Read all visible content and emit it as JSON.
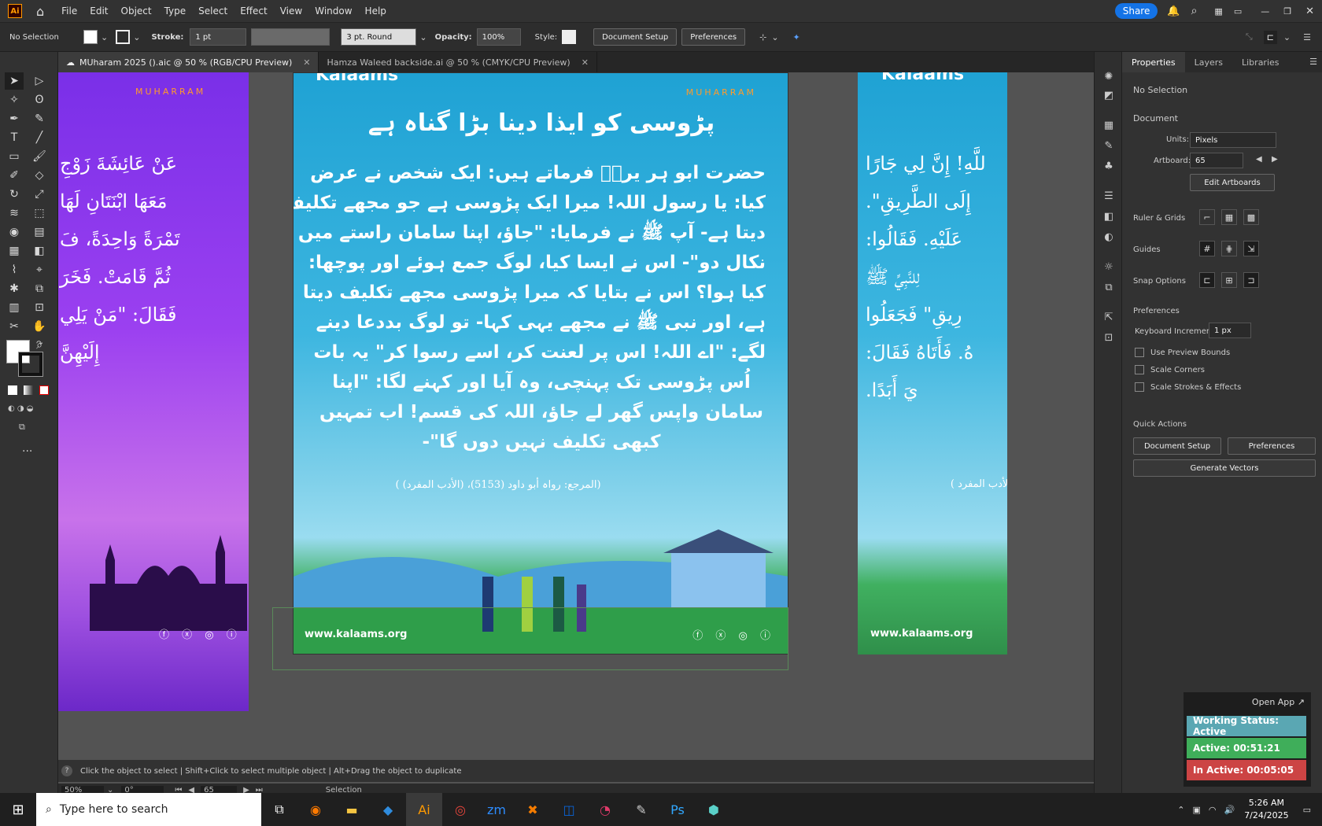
{
  "app": {
    "logo": "Ai",
    "menus": [
      "File",
      "Edit",
      "Object",
      "Type",
      "Select",
      "Effect",
      "View",
      "Window",
      "Help"
    ],
    "share_label": "Share"
  },
  "control_bar": {
    "selection": "No Selection",
    "stroke_label": "Stroke:",
    "stroke_value": "1 pt",
    "brush_value": "3 pt. Round",
    "opacity_label": "Opacity:",
    "opacity_value": "100%",
    "style_label": "Style:",
    "document_setup": "Document Setup",
    "preferences": "Preferences"
  },
  "tabs": [
    {
      "label": "MUharam 2025 ().aic @ 50 % (RGB/CPU Preview)",
      "active": true
    },
    {
      "label": "Hamza Waleed backside.ai @ 50 % (CMYK/CPU Preview)",
      "active": false
    }
  ],
  "artboards": {
    "left": {
      "brand": "MUHARRAM",
      "arabic_lines": [
        "عَنْ عَائِشَةَ زَوْجِ",
        "مَعَهَا ابْنَتَانِ لَهَا",
        "تَمْرَةً وَاحِدَةً، فَ",
        "ثُمَّ قَامَتْ. فَخَرَ",
        "فَقَالَ: \"مَنْ يَلِي",
        "إِلَيْهِنَّ"
      ]
    },
    "center": {
      "brand": "MUHARRAM",
      "logo_text": "Kalaams",
      "title": "پڑوسی کو ایذا دینا بڑا گناہ ہے",
      "body_lines": [
        "حضرت ابو ہر یرہؓ فرماتے ہیں: ایک شخص نے عرض",
        "کیا: یا رسول اللہ! میرا ایک پڑوسی ہے جو مجھے تکلیف",
        "دیتا ہے- آپ ﷺ نے فرمایا: \"جاؤ، اپنا سامان راستے میں",
        "نکال دو\"- اس نے ایسا کیا، لوگ جمع ہوئے اور پوچھا:",
        "کیا ہوا؟ اس نے بتایا کہ میرا پڑوسی مجھے تکلیف دیتا",
        "ہے، اور نبی ﷺ نے مجھے یہی کہا- تو لوگ بددعا دینے",
        "لگے: \"اے اللہ! اس پر لعنت کر، اسے رسوا کر\" یہ بات",
        "اُس پڑوسی تک پہنچی، وہ آیا اور کہنے لگا: \"اپنا",
        "سامان واپس گھر لے جاؤ، اللہ کی قسم! اب تمہیں",
        "کبھی تکلیف نہیں دوں گا\"-"
      ],
      "reference": "(المرجع: رواہ أبو داود (5153)، (الأدب المفرد) )",
      "website": "www.kalaams.org"
    },
    "right": {
      "logo_text": "Kalaams",
      "arabic_lines": [
        "للَّهِ! إِنَّ لِي جَارًا",
        "إِلَى الطَّرِيقِ\".",
        "عَلَيْهِ. فَقَالُوا:",
        "لِلنَّبِيِّ ﷺ",
        "رِيقِ\" فَجَعَلُوا",
        "هُ. فَأَتَاهُ فَقَالَ:",
        "يَ أَبَدًا."
      ],
      "reference": "(الأدب المفرد )",
      "website": "www.kalaams.org"
    }
  },
  "panel": {
    "tabs": [
      "Properties",
      "Layers",
      "Libraries"
    ],
    "selection": "No Selection",
    "document_label": "Document",
    "units_label": "Units:",
    "units_value": "Pixels",
    "artboard_label": "Artboard:",
    "artboard_value": "65",
    "edit_artboards": "Edit Artboards",
    "ruler_grids": "Ruler & Grids",
    "guides": "Guides",
    "snap_options": "Snap Options",
    "preferences_label": "Preferences",
    "keyboard_increment_label": "Keyboard Increment:",
    "keyboard_increment_value": "1 px",
    "checks": [
      "Use Preview Bounds",
      "Scale Corners",
      "Scale Strokes & Effects"
    ],
    "quick_actions": "Quick Actions",
    "document_setup": "Document Setup",
    "preferences": "Preferences",
    "generate_vectors": "Generate Vectors"
  },
  "status": {
    "hint": "Click the object to select  |  Shift+Click to select multiple object  |  Alt+Drag the object to duplicate",
    "zoom": "50%",
    "rotation": "0°",
    "artboard": "65",
    "tool": "Selection"
  },
  "tracker": {
    "open_app": "Open App ↗",
    "working": "Working Status: Active",
    "active": "Active: 00:51:21",
    "inactive": "In Active: 00:05:05"
  },
  "taskbar": {
    "search_placeholder": "Type here to search",
    "time": "5:26 AM",
    "date": "7/24/2025"
  },
  "colors": {
    "accent": "#1473e6",
    "working": "#5aa7b3",
    "active": "#3fae5a",
    "inactive": "#cc4444"
  }
}
